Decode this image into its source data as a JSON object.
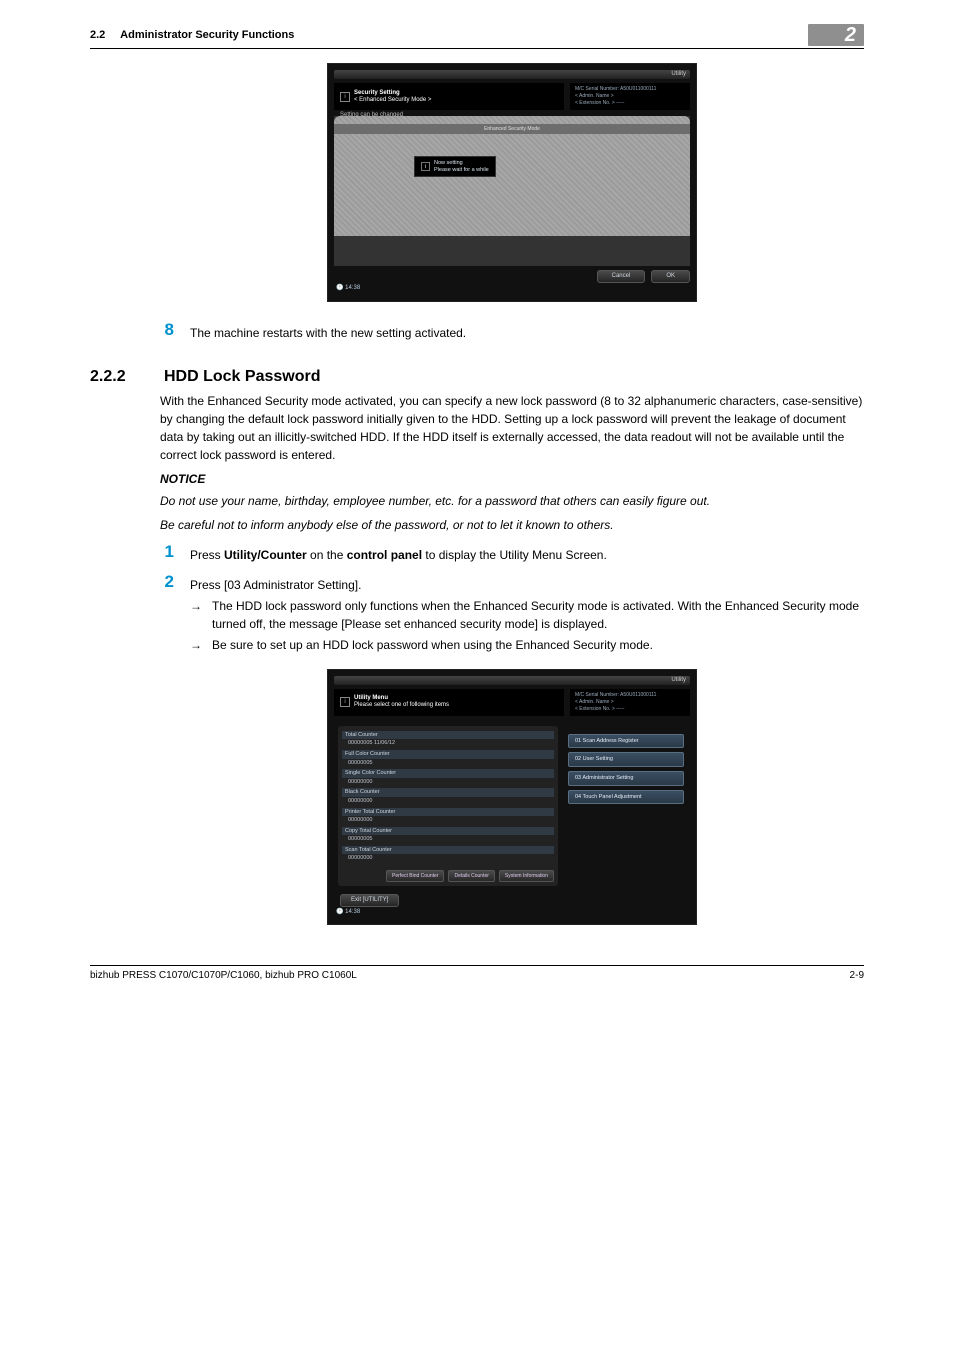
{
  "header": {
    "section_number": "2.2",
    "section_title": "Administrator Security Functions",
    "chapter_badge": "2"
  },
  "screenshot1": {
    "topbar_label": "Utility",
    "title_left_l1": "Security Setting",
    "title_left_l2": "< Enhanced Security Mode >",
    "title_right_l1": "M/C Serial Number: A50U011000111",
    "title_right_l2": "< Admin. Name >",
    "title_right_l3": "< Extension No. > -----",
    "msg_top": "Setting can be changed",
    "subbar": "Enhanced Security Mode",
    "dialog": "Now setting\nPlease wait for a while",
    "btn_cancel": "Cancel",
    "btn_ok": "OK",
    "clock": "14:38"
  },
  "step8": {
    "num": "8",
    "text": "The machine restarts with the new setting activated."
  },
  "subsection": {
    "num": "2.2.2",
    "title": "HDD Lock Password"
  },
  "para1": "With the Enhanced Security mode activated, you can specify a new lock password (8 to 32 alphanumeric characters, case-sensitive) by changing the default lock password initially given to the HDD. Setting up a lock password will prevent the leakage of document data by taking out an illicitly-switched HDD. If the HDD itself is externally accessed, the data readout will not be available until the correct lock password is entered.",
  "notice_h": "NOTICE",
  "notice1": "Do not use your name, birthday, employee number, etc. for a password that others can easily figure out.",
  "notice2": "Be careful not to inform anybody else of the password, or not to let it known to others.",
  "step1": {
    "num": "1",
    "pre": "Press ",
    "b1": "Utility/Counter",
    "mid": " on the ",
    "b2": "control panel",
    "post": " to display the Utility Menu Screen."
  },
  "step2": {
    "num": "2",
    "text": "Press [03 Administrator Setting].",
    "bullet1": "The HDD lock password only functions when the Enhanced Security mode is activated. With the Enhanced Security mode turned off, the message [Please set enhanced security mode] is displayed.",
    "bullet2": "Be sure to set up an HDD lock password when using the Enhanced Security mode."
  },
  "screenshot2": {
    "topbar_label": "Utility",
    "title_left_l1": "Utility Menu",
    "title_left_l2": "Please select one of following items",
    "title_right_l1": "M/C Serial Number: A50U011000111",
    "title_right_l2": "< Admin. Name >",
    "title_right_l3": "< Extension No. > -----",
    "left_items": [
      {
        "head": "Total Counter",
        "val": "00000005    11/06/12"
      },
      {
        "head": "Full Color Counter",
        "val": "00000005"
      },
      {
        "head": "Single Color Counter",
        "val": "00000000"
      },
      {
        "head": "Black Counter",
        "val": "00000000"
      },
      {
        "head": "Printer Total Counter",
        "val": "00000000"
      },
      {
        "head": "Copy Total Counter",
        "val": "00000005"
      },
      {
        "head": "Scan Total Counter",
        "val": "00000000"
      }
    ],
    "mini_btns": [
      "Perfect Bind Counter",
      "Details Counter",
      "System Information"
    ],
    "right_opts": [
      "01 Scan Address Register",
      "02 User Setting",
      "03 Administrator Setting",
      "04 Touch Panel Adjustment"
    ],
    "exit": "Exit [UTILITY]",
    "clock": "14:38"
  },
  "footer": {
    "left": "bizhub PRESS C1070/C1070P/C1060, bizhub PRO C1060L",
    "right": "2-9"
  }
}
